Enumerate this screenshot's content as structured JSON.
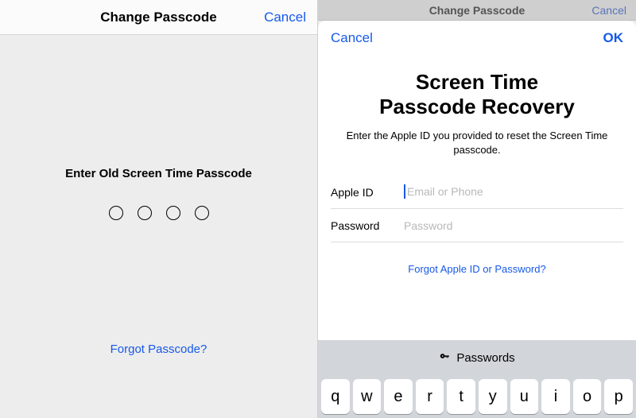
{
  "colors": {
    "link": "#1659ea"
  },
  "left": {
    "title": "Change Passcode",
    "cancel": "Cancel",
    "prompt": "Enter Old Screen Time Passcode",
    "forgot": "Forgot Passcode?"
  },
  "right": {
    "bg_title": "Change Passcode",
    "bg_cancel": "Cancel",
    "sheet": {
      "cancel": "Cancel",
      "ok": "OK",
      "title_l1": "Screen Time",
      "title_l2": "Passcode Recovery",
      "subtitle": "Enter the Apple ID you provided to reset the Screen Time passcode.",
      "apple_id_label": "Apple ID",
      "apple_id_placeholder": "Email or Phone",
      "password_label": "Password",
      "password_placeholder": "Password",
      "forgot": "Forgot Apple ID or Password?"
    },
    "keyboard": {
      "header": "Passwords",
      "keys": [
        "q",
        "w",
        "e",
        "r",
        "t",
        "y",
        "u",
        "i",
        "o",
        "p"
      ]
    }
  }
}
